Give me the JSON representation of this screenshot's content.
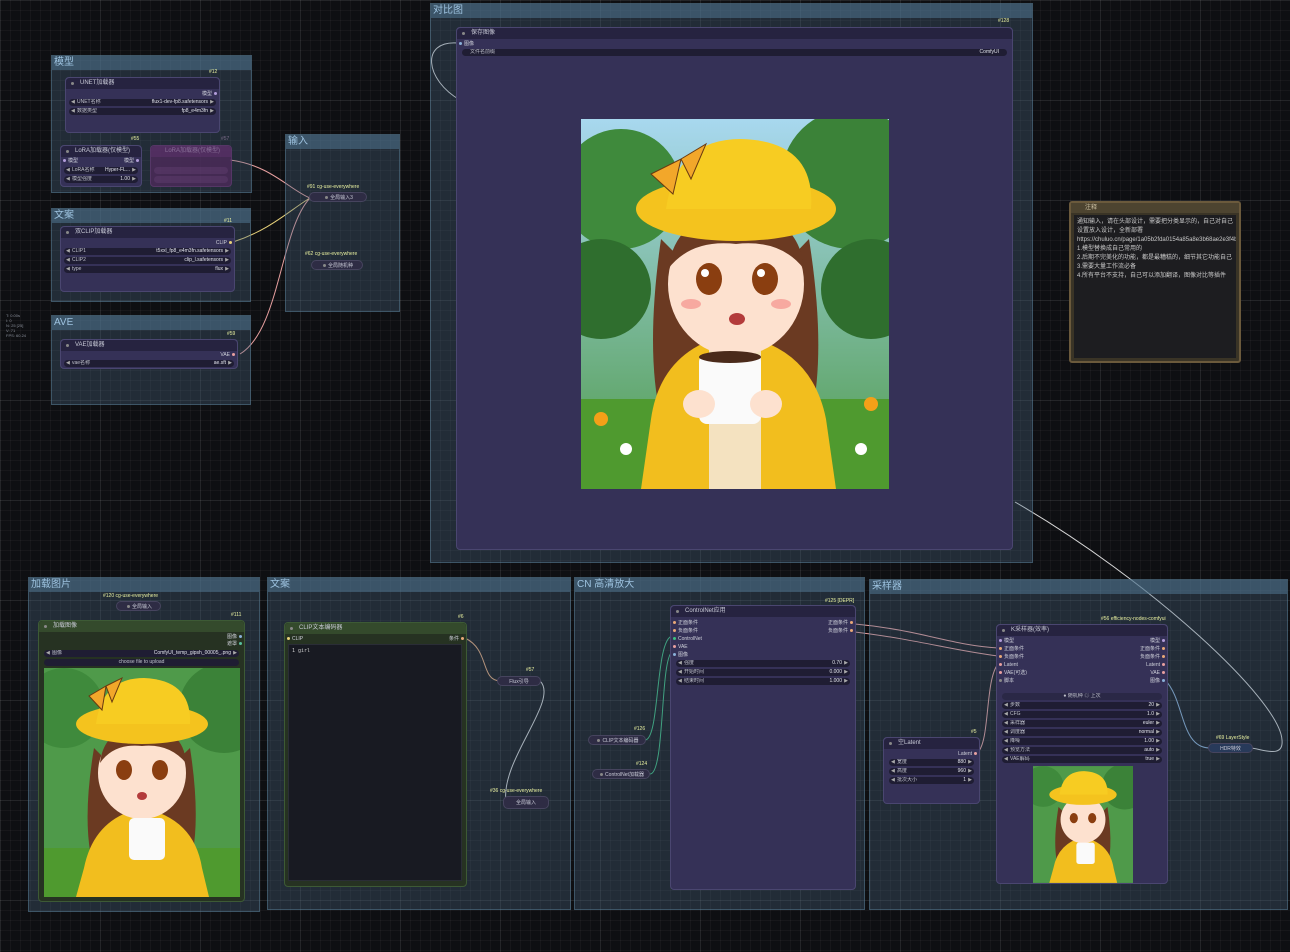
{
  "canvas_info": {
    "lines": [
      "T: 0.00s",
      "I: 0",
      "N: 25 [25]",
      "V: 71",
      "FPS: 60.24"
    ]
  },
  "colors": {
    "accent_yellow": "#e8f0a0",
    "group_blue": "#486880",
    "node_purple": "#353157",
    "link_pink": "#e8a0a0",
    "link_green": "#3cc080",
    "link_white": "#dddddd"
  },
  "groups": {
    "model": "模型",
    "text_left": "文案",
    "vae": "AVE",
    "input": "输入",
    "compare": "对比图",
    "load_image": "加载图片",
    "text_bottom": "文案",
    "cn_upscale": "CN 高清放大",
    "sampler": "采样器"
  },
  "unet": {
    "id": "#12",
    "title": "UNET加载器",
    "output": "模型",
    "name_label": "UNET名称",
    "name_value": "flux1-dev-fp8.safetensors",
    "dtype_label": "数据类型",
    "dtype_value": "fp8_e4m3fn"
  },
  "lora": {
    "id": "#55",
    "title": "LoRA加载器(仅模型)",
    "in": "模型",
    "out": "模型",
    "name_label": "LoRA名称",
    "name_value": "Hyper-FL...",
    "strength_label": "模型强度",
    "strength_value": "1.00"
  },
  "lora_bypassed": {
    "title": "LoRA加载器(仅模型)",
    "id": "#57"
  },
  "dual_clip": {
    "id": "#11",
    "title": "双CLIP加载器",
    "output": "CLIP",
    "clip1_label": "CLIP1",
    "clip1_value": "t5xxl_fp8_e4m3fn.safetensors",
    "clip2_label": "CLIP2",
    "clip2_value": "clip_l.safetensors",
    "type_label": "type",
    "type_value": "flux"
  },
  "vae": {
    "id": "#59",
    "title": "VAE加载器",
    "output": "VAE",
    "name_label": "vae名称",
    "name_value": "ae.sft"
  },
  "anywhere1": {
    "id": "#91 cg-use-everywhere",
    "label": "全局输入3"
  },
  "anywhere2": {
    "id": "#62 cg-use-everywhere",
    "label": "全局随机种"
  },
  "save_image": {
    "id": "#128",
    "title": "保存图像",
    "input": "图像",
    "prefix_label": "文件名前缀",
    "prefix_value": "ComfyUI"
  },
  "note": {
    "title": "注释",
    "body": "通知输入，请在头部设计，需要把分类显示的，自己对自己设置放入设计，全新部署https://chuluo.cn/page/1a05b2fda0154a85a8e3b68ae2e3f4b76\n1.模型替换成自己常用的\n2.后期不完美化的功能，都是最糟糕的，细节其它功能自己\n3.需要大量工作流必备\n4.所有平台不支持，自己可以添加翻译，图像对比等插件"
  },
  "anywhere3": {
    "id": "#120 cg-use-everywhere",
    "label": "全局输入"
  },
  "load_image": {
    "id": "#111",
    "title": "加载图像",
    "out1": "图像",
    "out2": "遮罩",
    "image_label": "图像",
    "image_value": "ComfyUI_temp_gipsh_00005_.png",
    "upload_label": "choose file to upload"
  },
  "clip_encode": {
    "id": "#6",
    "title": "CLIP文本编码器",
    "in": "CLIP",
    "out": "条件",
    "text": "1 girl"
  },
  "flux_guide": {
    "id": "#57",
    "label": "Flux引导"
  },
  "anywhere4": {
    "id": "#36 cg-use-everywhere",
    "label": "全局输入"
  },
  "controlnet": {
    "id": "#125 [DEPR]",
    "title": "ControlNet应用",
    "in_pos": "正面条件",
    "in_neg": "负面条件",
    "in_cn": "ControlNet",
    "in_vae": "VAE",
    "in_img": "图像",
    "out_pos": "正面条件",
    "out_neg": "负面条件",
    "strength_label": "强度",
    "strength_value": "0.70",
    "start_label": "开始时间",
    "start_value": "0.000",
    "end_label": "结束时间",
    "end_value": "1.000"
  },
  "clip_encode_collapsed": {
    "id": "#126",
    "label": "CLIP文本编码器"
  },
  "cn_loader_collapsed": {
    "id": "#124",
    "label": "ControlNet加载器"
  },
  "latent": {
    "id": "#5",
    "title": "空Latent",
    "out": "Latent",
    "width_label": "宽度",
    "width_value": "880",
    "height_label": "高度",
    "height_value": "960",
    "batch_label": "批次大小",
    "batch_value": "1"
  },
  "ksampler": {
    "id": "#56 efficiency-nodes-comfyui",
    "title": "K采样器(效率)",
    "in": [
      "模型",
      "正面条件",
      "负面条件",
      "Latent",
      "VAE(可选)",
      "脚本"
    ],
    "out": [
      "模型",
      "正面条件",
      "负面条件",
      "Latent",
      "VAE",
      "图像"
    ],
    "seed_label": "随机种",
    "seed_mode": "上次",
    "rows": [
      [
        "步数",
        "20"
      ],
      [
        "CFG",
        "1.0"
      ],
      [
        "采样器",
        "euler"
      ],
      [
        "调度器",
        "normal"
      ],
      [
        "降噪",
        "1.00"
      ],
      [
        "预览方法",
        "auto"
      ],
      [
        "VAE解码",
        "true"
      ]
    ]
  },
  "layerstyle": {
    "id": "#69 LayerStyle",
    "label": "HDR特效"
  }
}
